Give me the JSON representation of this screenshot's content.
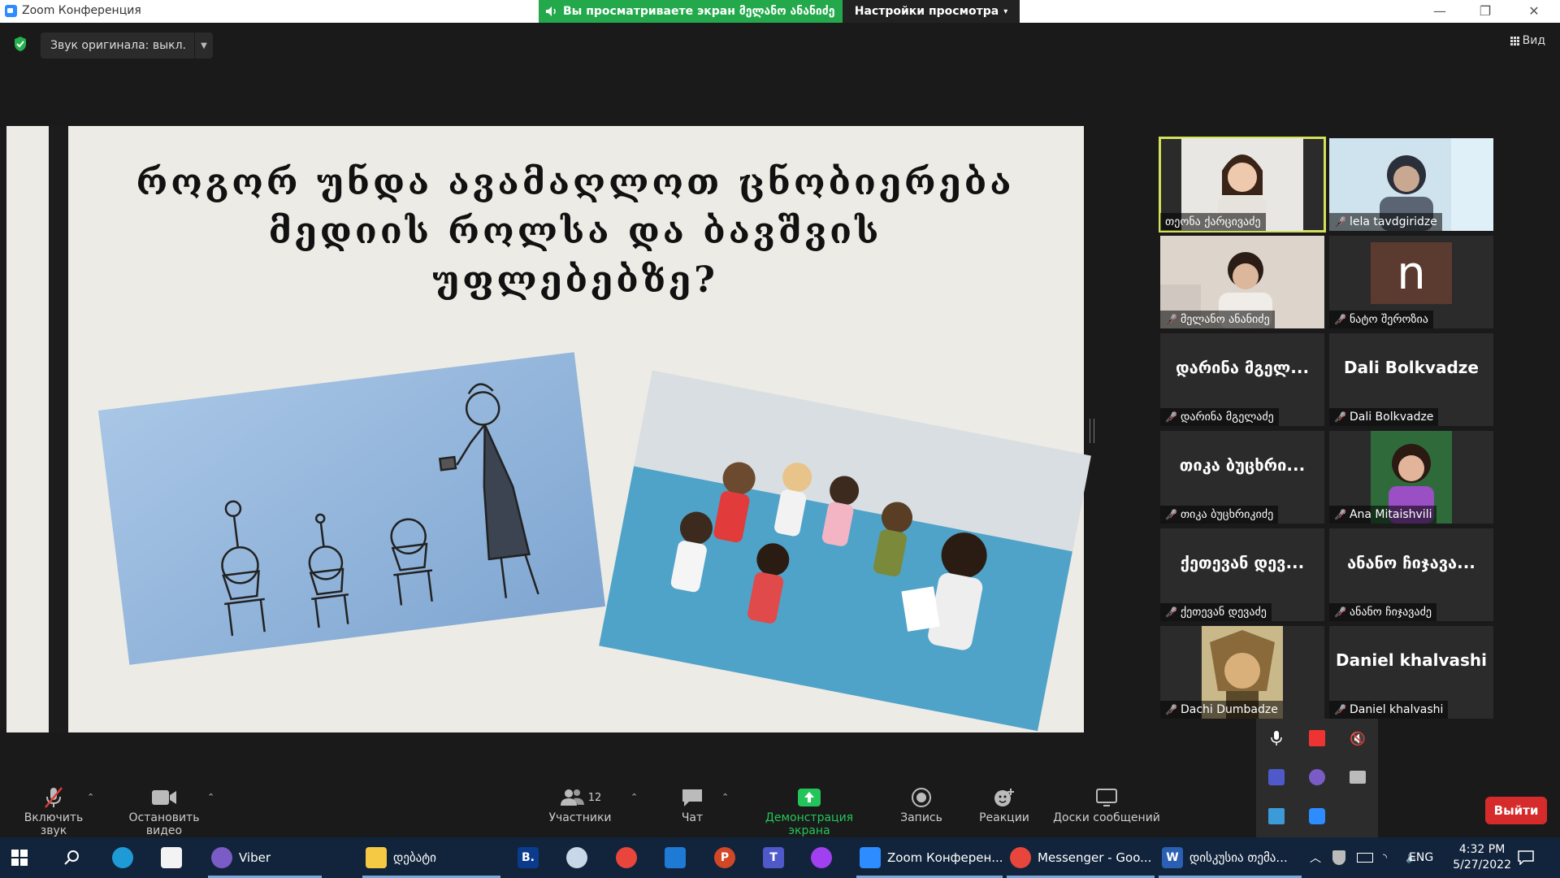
{
  "window": {
    "title": "Zoom Конференция",
    "share_banner": "Вы просматриваете экран მელანო ანანიძე",
    "view_settings": "Настройки просмотра",
    "audio_original": "Звук оригинала: выкл.",
    "view_label": "Вид"
  },
  "slide": {
    "title_line1": "როგორ უნდა ავამაღლოთ ცნობიერება",
    "title_line2": "მედიის როლსა და ბავშვის",
    "title_line3": "უფლებებზე?"
  },
  "participants": [
    {
      "name": "თეონა ქარცივაძე",
      "tile": "video",
      "active": true,
      "muted": false
    },
    {
      "name": "lela tavdgiridze",
      "tile": "video",
      "active": false,
      "muted": true
    },
    {
      "name": "მელანო ანანიძე",
      "tile": "video",
      "active": false,
      "muted": true
    },
    {
      "name": "ნატო შეროზია",
      "tile": "avatar",
      "avatar_letter": "n",
      "active": false,
      "muted": true
    },
    {
      "name": "დარინა მგელაძე",
      "tile": "text",
      "display": "დარინა მგელ...",
      "active": false,
      "muted": true
    },
    {
      "name": "Dali Bolkvadze",
      "tile": "text",
      "display": "Dali Bolkvadze",
      "active": false,
      "muted": true
    },
    {
      "name": "თიკა ბუცხრიკიძე",
      "tile": "text",
      "display": "თიკა ბუცხრი...",
      "active": false,
      "muted": true
    },
    {
      "name": "Ana Mitaishvili",
      "tile": "video",
      "active": false,
      "muted": true
    },
    {
      "name": "ქეთევან დევაძე",
      "tile": "text",
      "display": "ქეთევან დევ...",
      "active": false,
      "muted": true
    },
    {
      "name": "ანანო ჩიჯავაძე",
      "tile": "text",
      "display": "ანანო ჩიჯავა...",
      "active": false,
      "muted": true
    },
    {
      "name": "Dachi Dumbadze",
      "tile": "video",
      "active": false,
      "muted": true
    },
    {
      "name": "Daniel khalvashi",
      "tile": "text",
      "display": "Daniel khalvashi",
      "active": false,
      "muted": true
    }
  ],
  "toolbar": {
    "unmute": "Включить звук",
    "stop_video": "Остановить видео",
    "participants": "Участники",
    "participants_count": "12",
    "chat": "Чат",
    "share": "Демонстрация экрана",
    "record": "Запись",
    "reactions": "Реакции",
    "whiteboards": "Доски сообщений",
    "leave": "Выйти"
  },
  "taskbar": {
    "viber": "Viber",
    "folder": "დებატი",
    "zoom": "Zoom Конферен...",
    "chrome": "Messenger - Goo...",
    "word": "დისკუსია თემა...",
    "lang": "ENG",
    "time": "4:32 PM",
    "date": "5/27/2022"
  },
  "colors": {
    "share_banner": "#23a94c",
    "active_speaker": "#d3e05a",
    "leave": "#d62b2b",
    "taskbar": "#12243c"
  }
}
